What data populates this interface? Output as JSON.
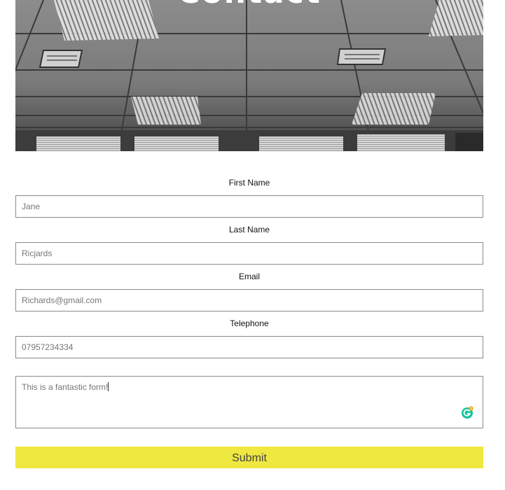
{
  "hero": {
    "title": "Contact"
  },
  "form": {
    "fields": [
      {
        "label": "First Name",
        "value": "Jane"
      },
      {
        "label": "Last Name",
        "value": "Ricjards"
      },
      {
        "label": "Email",
        "value": "Richards@gmail.com"
      },
      {
        "label": "Telephone",
        "value": "07957234334"
      }
    ],
    "message": "This is a fantastic form!",
    "grammarly_badge": "1",
    "submit_label": "Submit"
  },
  "colors": {
    "submit_background": "#efe840",
    "grammarly_green": "#15c39a",
    "badge_orange": "#f5a623"
  },
  "icons": {
    "grammarly": "grammarly-icon"
  }
}
